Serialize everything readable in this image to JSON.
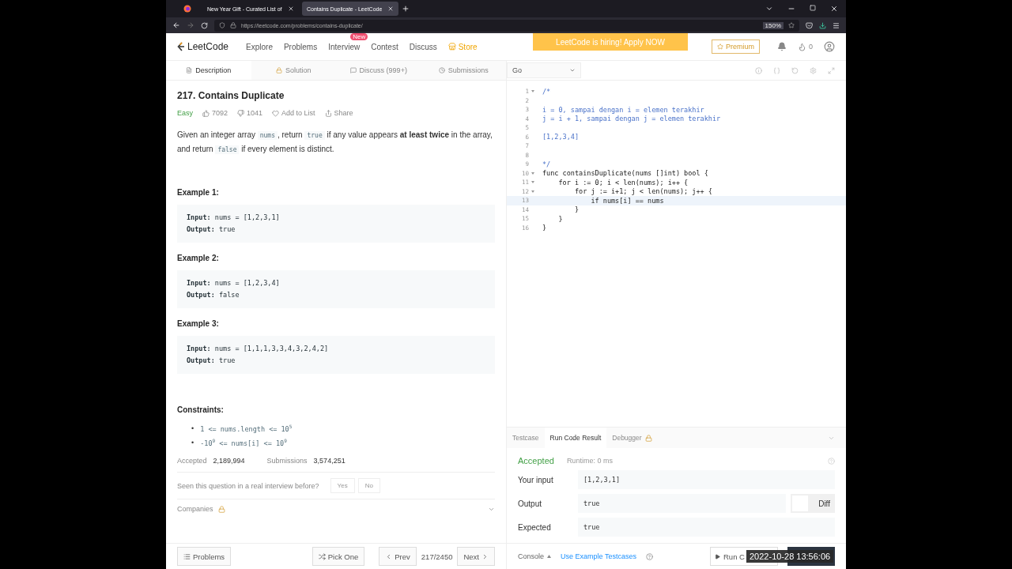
{
  "browser": {
    "tabs": [
      {
        "title": "New Year Gift - Curated List of",
        "selected": false
      },
      {
        "title": "Contains Duplicate - LeetCode",
        "selected": true
      }
    ],
    "url": "https://leetcode.com/problems/contains-duplicate/",
    "zoom": "150%"
  },
  "nav": {
    "logo": "LeetCode",
    "links": [
      {
        "label": "Explore"
      },
      {
        "label": "Problems"
      },
      {
        "label": "Interview",
        "badge": "New"
      },
      {
        "label": "Contest"
      },
      {
        "label": "Discuss"
      },
      {
        "label": "Store",
        "kind": "store"
      }
    ],
    "banner": "LeetCode is hiring! Apply NOW",
    "premium": "Premium",
    "coins": "0"
  },
  "left_tabs": [
    {
      "label": "Description",
      "selected": true
    },
    {
      "label": "Solution",
      "selected": false
    },
    {
      "label": "Discuss (999+)",
      "selected": false
    },
    {
      "label": "Submissions",
      "selected": false
    }
  ],
  "problem": {
    "title": "217. Contains Duplicate",
    "difficulty": "Easy",
    "likes": "7092",
    "dislikes": "1041",
    "add_to_list": "Add to List",
    "share": "Share",
    "description": [
      {
        "kind": "text",
        "text": "Given an integer array "
      },
      {
        "kind": "code",
        "text": "nums"
      },
      {
        "kind": "text",
        "text": ", return "
      },
      {
        "kind": "code",
        "text": "true"
      },
      {
        "kind": "text",
        "text": " if any value appears "
      },
      {
        "kind": "bold",
        "text": "at least twice"
      },
      {
        "kind": "text",
        "text": " in the array, and return "
      },
      {
        "kind": "code",
        "text": "false"
      },
      {
        "kind": "text",
        "text": " if every element is distinct."
      }
    ],
    "examples": [
      {
        "title": "Example 1:",
        "input_label": "Input:",
        "input": "nums = [1,2,3,1]",
        "output_label": "Output:",
        "output": "true"
      },
      {
        "title": "Example 2:",
        "input_label": "Input:",
        "input": "nums = [1,2,3,4]",
        "output_label": "Output:",
        "output": "false"
      },
      {
        "title": "Example 3:",
        "input_label": "Input:",
        "input": "nums = [1,1,1,3,3,4,3,2,4,2]",
        "output_label": "Output:",
        "output": "true"
      }
    ],
    "constraints_title": "Constraints:",
    "constraints": [
      {
        "bullet": "•",
        "text": "1 <= nums.length <= 10$^{5}$"
      },
      {
        "bullet": "•",
        "text": "-10$^{9}$ <= nums[i] <= 10$^{9}$"
      }
    ],
    "accepted_label": "Accepted",
    "accepted": "2,189,994",
    "submissions_label": "Submissions",
    "submissions": "3,574,251",
    "seen_question": "Seen this question in a real interview before?",
    "yes": "Yes",
    "no": "No",
    "companies": "Companies"
  },
  "left_footer": {
    "problems": "Problems",
    "pick_one": "Pick One",
    "prev": "Prev",
    "position": "217/2450",
    "next": "Next"
  },
  "editor": {
    "language": "Go",
    "lines": [
      {
        "number": "1",
        "text": "/*",
        "kind": "comment",
        "fold": true,
        "highlighted": false
      },
      {
        "number": "2",
        "fold": false,
        "highlighted": false
      },
      {
        "number": "3",
        "text": "i = 0, sampai dengan i = elemen terakhir",
        "kind": "comment",
        "fold": false,
        "highlighted": false
      },
      {
        "number": "4",
        "text": "j = i + 1, sampai dengan j = elemen terakhir",
        "kind": "comment",
        "fold": false,
        "highlighted": false
      },
      {
        "number": "5",
        "fold": false,
        "highlighted": false
      },
      {
        "number": "6",
        "text": "[1,2,3,4]",
        "kind": "comment",
        "fold": false,
        "highlighted": false
      },
      {
        "number": "7",
        "fold": false,
        "highlighted": false
      },
      {
        "number": "8",
        "fold": false,
        "highlighted": false
      },
      {
        "number": "9",
        "text": "*/",
        "kind": "comment",
        "fold": false,
        "highlighted": false
      },
      {
        "number": "10",
        "text": "func containsDuplicate(nums []int) bool {",
        "kind": "code",
        "fold": true,
        "highlighted": false
      },
      {
        "number": "11",
        "text": "    for i := 0; i < len(nums); i++ {",
        "kind": "code",
        "fold": true,
        "highlighted": false
      },
      {
        "number": "12",
        "text": "        for j := i+1; j < len(nums); j++ {",
        "kind": "code",
        "fold": true,
        "highlighted": false
      },
      {
        "number": "13",
        "text": "            if nums[i] == nums",
        "kind": "code",
        "fold": false,
        "highlighted": true
      },
      {
        "number": "14",
        "text": "        }",
        "kind": "code",
        "fold": false,
        "highlighted": false
      },
      {
        "number": "15",
        "text": "    }",
        "kind": "code",
        "fold": false,
        "highlighted": false
      },
      {
        "number": "16",
        "text": "}",
        "kind": "code",
        "fold": false,
        "highlighted": false
      }
    ]
  },
  "console_tabs": [
    {
      "label": "Testcase",
      "selected": false
    },
    {
      "label": "Run Code Result",
      "selected": true
    },
    {
      "label": "Debugger",
      "selected": false,
      "locked": true
    }
  ],
  "result": {
    "status": "Accepted",
    "runtime": "Runtime: 0 ms",
    "rows": [
      {
        "label": "Your input",
        "value": "[1,2,3,1]"
      },
      {
        "label": "Output",
        "value": "true",
        "diff": "Diff"
      },
      {
        "label": "Expected",
        "value": "true"
      }
    ]
  },
  "right_footer": {
    "console": "Console",
    "example_testcases": "Use Example Testcases",
    "run": "Run C"
  },
  "timestamp": "2022-10-28 13:56:06"
}
